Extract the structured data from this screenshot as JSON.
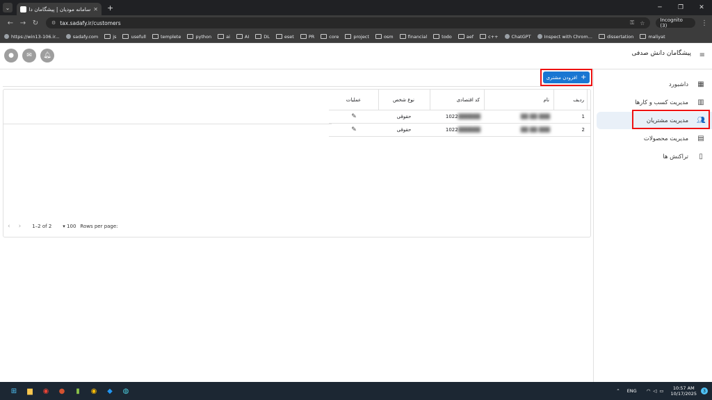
{
  "browser": {
    "tab_title": "سامانه مودیان | پیشگامان دانش ...",
    "address": "tax.sadafy.ir/customers",
    "incognito_label": "Incognito (3)",
    "bookmarks": [
      "https://win13-106.ir...",
      "sadafy.com",
      "js",
      "usefull",
      "templete",
      "python",
      "ai",
      "AI",
      "DL",
      "eset",
      "PR",
      "core",
      "project",
      "osm",
      "financial",
      "todo",
      "aef",
      "c++",
      "ChatGPT",
      "Inspect with Chrom...",
      "dissertation",
      "maliyat"
    ]
  },
  "app": {
    "brand": "پیشگامان دانش صدفی",
    "sidebar": [
      {
        "label": "داشبورد",
        "icon": "dashboard-icon"
      },
      {
        "label": "مدیریت کسب و کارها",
        "icon": "business-icon"
      },
      {
        "label": "مدیریت مشتریان",
        "icon": "people-icon",
        "active": true
      },
      {
        "label": "مدیریت محصولات",
        "icon": "box-icon"
      },
      {
        "label": "تراکنش ها",
        "icon": "receipt-icon"
      }
    ],
    "add_button": "افزودن مشتری",
    "table": {
      "headers": {
        "idx": "ردیف",
        "name": "نام",
        "code": "کد اقتصادی",
        "type": "نوع شخص",
        "ops": "عملیات"
      },
      "rows": [
        {
          "idx": "1",
          "name": "██ ██ ███",
          "code": "1022",
          "code_hidden": "██████",
          "type": "حقوقی"
        },
        {
          "idx": "2",
          "name": "██ ██ ███",
          "code": "1022",
          "code_hidden": "██████",
          "type": "حقوقی"
        }
      ]
    },
    "pagination": {
      "rows_per_page_label": "Rows per page:",
      "rows_per_page": "100",
      "range": "1–2 of 2"
    }
  },
  "taskbar": {
    "lang": "ENG",
    "time": "10:57 AM",
    "date": "10/17/2025",
    "notifications": "3"
  }
}
